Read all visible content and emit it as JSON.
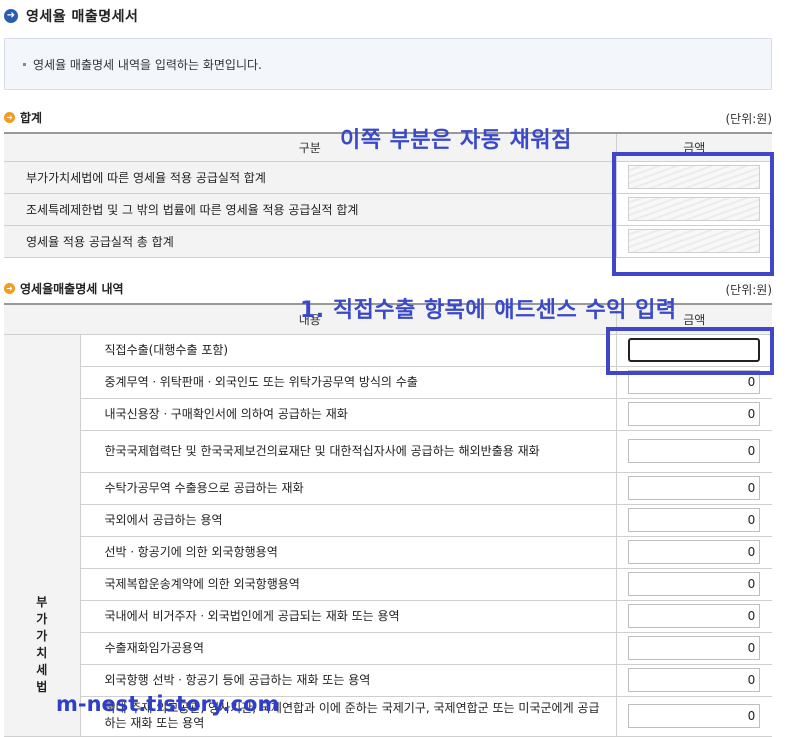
{
  "page": {
    "title": "영세율 매출명세서",
    "description": "영세율 매출명세 내역을 입력하는 화면입니다."
  },
  "summary": {
    "title": "합계",
    "unit": "(단위:원)",
    "col_category": "구분",
    "col_amount": "금액",
    "rows": [
      {
        "label": "부가가치세법에 따른 영세율 적용 공급실적 합계"
      },
      {
        "label": "조세특례제한법 및 그 밖의 법률에 따른 영세율 적용 공급실적 합계"
      },
      {
        "label": "영세율 적용 공급실적 총 합계"
      }
    ]
  },
  "detail": {
    "title": "영세율매출명세 내역",
    "unit": "(단위:원)",
    "col_content": "내용",
    "col_amount": "금액",
    "category": "부\n가\n가\n치\n세\n법",
    "rows": [
      {
        "label": "직접수출(대행수출 포함)",
        "value": ""
      },
      {
        "label": "중계무역ㆍ위탁판매ㆍ외국인도 또는 위탁가공무역 방식의 수출",
        "value": "0"
      },
      {
        "label": "내국신용장ㆍ구매확인서에 의하여 공급하는 재화",
        "value": "0"
      },
      {
        "label": "한국국제협력단 및 한국국제보건의료재단 및 대한적십자사에 공급하는 해외반출용 재화",
        "value": "0"
      },
      {
        "label": "수탁가공무역 수출용으로 공급하는 재화",
        "value": "0"
      },
      {
        "label": "국외에서 공급하는 용역",
        "value": "0"
      },
      {
        "label": "선박ㆍ항공기에 의한 외국항행용역",
        "value": "0"
      },
      {
        "label": "국제복합운송계약에 의한 외국항행용역",
        "value": "0"
      },
      {
        "label": "국내에서 비거주자ㆍ외국법인에게 공급되는 재화 또는 용역",
        "value": "0"
      },
      {
        "label": "수출재화임가공용역",
        "value": "0"
      },
      {
        "label": "외국항행 선박ㆍ항공기 등에 공급하는 재화 또는 용역",
        "value": "0"
      },
      {
        "label": "국내 주재 외교공관, 영사기관, 국제연합과 이에 준하는 국제기구, 국제연합군 또는 미국군에게 공급하는 재화 또는 용역",
        "value": "0"
      }
    ]
  },
  "annotations": {
    "auto_fill": "이쪽 부분은 자동 채워짐",
    "direct_export": "1. 직접수출 항목에 애드센스 수익 입력",
    "watermark": "m-nest.tistory.com"
  },
  "colors": {
    "highlight": "#3f47c8",
    "section_icon": "#f39b1f",
    "title_icon": "#2a5db0"
  },
  "icons": {
    "title": "arrow-right-circle-icon",
    "section": "arrow-right-circle-small-icon"
  }
}
